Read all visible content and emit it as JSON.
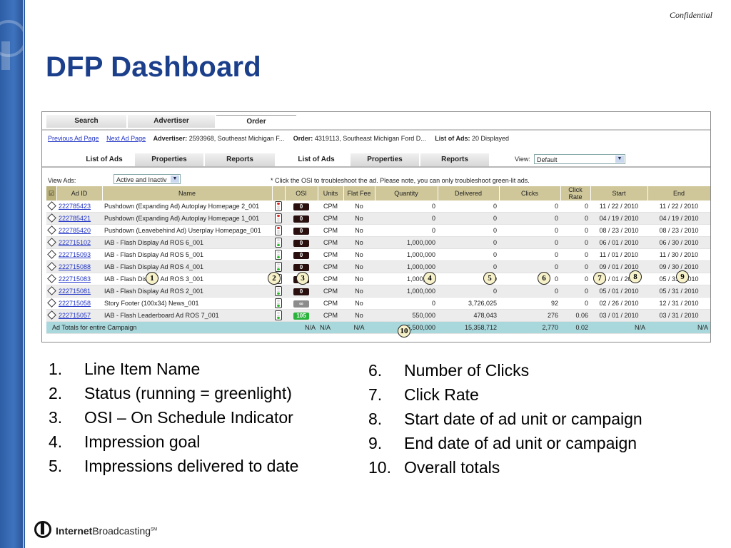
{
  "header": {
    "confidential": "Confidential",
    "title": "DFP Dashboard"
  },
  "tabs1": [
    "Search",
    "Advertiser",
    "Order"
  ],
  "info": {
    "prev_link": "Previous Ad Page",
    "next_link": "Next Ad Page",
    "advertiser_label": "Advertiser:",
    "advertiser_value": "2593968, Southeast Michigan F...",
    "order_label": "Order:",
    "order_value": "4319113, Southeast Michigan Ford D...",
    "list_label": "List of Ads:",
    "list_value": "20 Displayed"
  },
  "tabs2": [
    "List of Ads",
    "Properties",
    "Reports",
    "List of Ads",
    "Properties",
    "Reports"
  ],
  "view": {
    "label": "View:",
    "value": "Default"
  },
  "view_ads": {
    "label": "View Ads:",
    "value": "Active and Inactiv"
  },
  "note": "* Click the OSI to troubleshoot the ad. Please note, you can only troubleshoot green-lit ads.",
  "columns": [
    "Ad ID",
    "Name",
    "OSI",
    "Units",
    "Flat Fee",
    "Quantity",
    "Delivered",
    "Clicks",
    "Click Rate",
    "Start",
    "End"
  ],
  "rows": [
    {
      "id": "222785423",
      "name": "Pushdown (Expanding Ad) Autoplay Homepage 2_001",
      "status": "red",
      "osi": "0",
      "units": "CPM",
      "flat": "No",
      "qty": "0",
      "del": "0",
      "clicks": "0",
      "rate": "0",
      "start": "11 / 22 / 2010",
      "end": "11 / 22 / 2010"
    },
    {
      "id": "222785421",
      "name": "Pushdown (Expanding Ad) Autoplay Homepage 1_001",
      "status": "red",
      "osi": "0",
      "units": "CPM",
      "flat": "No",
      "qty": "0",
      "del": "0",
      "clicks": "0",
      "rate": "0",
      "start": "04 / 19 / 2010",
      "end": "04 / 19 / 2010"
    },
    {
      "id": "222785420",
      "name": "Pushdown (Leavebehind Ad) Userplay Homepage_001",
      "status": "red",
      "osi": "0",
      "units": "CPM",
      "flat": "No",
      "qty": "0",
      "del": "0",
      "clicks": "0",
      "rate": "0",
      "start": "08 / 23 / 2010",
      "end": "08 / 23 / 2010"
    },
    {
      "id": "222715102",
      "name": "IAB - Flash Display Ad ROS 6_001",
      "status": "green",
      "osi": "0",
      "units": "CPM",
      "flat": "No",
      "qty": "1,000,000",
      "del": "0",
      "clicks": "0",
      "rate": "0",
      "start": "06 / 01 / 2010",
      "end": "06 / 30 / 2010"
    },
    {
      "id": "222715093",
      "name": "IAB - Flash Display Ad ROS 5_001",
      "status": "green",
      "osi": "0",
      "units": "CPM",
      "flat": "No",
      "qty": "1,000,000",
      "del": "0",
      "clicks": "0",
      "rate": "0",
      "start": "11 / 01 / 2010",
      "end": "11 / 30 / 2010"
    },
    {
      "id": "222715088",
      "name": "IAB - Flash Display Ad ROS 4_001",
      "status": "green",
      "osi": "0",
      "units": "CPM",
      "flat": "No",
      "qty": "1,000,000",
      "del": "0",
      "clicks": "0",
      "rate": "0",
      "start": "09 / 01 / 2010",
      "end": "09 / 30 / 2010"
    },
    {
      "id": "222715083",
      "name": "IAB - Flash Display Ad ROS 3_001",
      "status": "green",
      "osi": "0",
      "units": "CPM",
      "flat": "No",
      "qty": "1,000,000",
      "del": "0",
      "clicks": "0",
      "rate": "0",
      "start": "05 / 01 / 2010",
      "end": "05 / 31 / 2010"
    },
    {
      "id": "222715081",
      "name": "IAB - Flash Display Ad ROS 2_001",
      "status": "green",
      "osi": "0",
      "units": "CPM",
      "flat": "No",
      "qty": "1,000,000",
      "del": "0",
      "clicks": "0",
      "rate": "0",
      "start": "05 / 01 / 2010",
      "end": "05 / 31 / 2010"
    },
    {
      "id": "222715058",
      "name": "Story Footer (100x34) News_001",
      "status": "green",
      "osi": "∞",
      "units": "CPM",
      "flat": "No",
      "qty": "0",
      "del": "3,726,025",
      "clicks": "92",
      "rate": "0",
      "start": "02 / 26 / 2010",
      "end": "12 / 31 / 2010"
    },
    {
      "id": "222715057",
      "name": "IAB - Flash Leaderboard Ad ROS 7_001",
      "status": "green",
      "osi": "105",
      "units": "CPM",
      "flat": "No",
      "qty": "550,000",
      "del": "478,043",
      "clicks": "276",
      "rate": "0.06",
      "start": "03 / 01 / 2010",
      "end": "03 / 31 / 2010"
    }
  ],
  "totals": {
    "label": "Ad Totals for entire Campaign",
    "osi": "N/A",
    "units": "N/A",
    "flat": "N/A",
    "qty": "15,500,000",
    "del": "15,358,712",
    "clicks": "2,770",
    "rate": "0.02",
    "start": "N/A",
    "end": "N/A"
  },
  "callouts": [
    "1",
    "2",
    "3",
    "4",
    "5",
    "6",
    "7",
    "8",
    "9",
    "10"
  ],
  "legend_left": [
    {
      "n": "1.",
      "t": "Line Item Name"
    },
    {
      "n": "2.",
      "t": "Status (running = greenlight)"
    },
    {
      "n": "3.",
      "t": "OSI – On Schedule Indicator"
    },
    {
      "n": "4.",
      "t": "Impression goal"
    },
    {
      "n": "5.",
      "t": "Impressions delivered to date"
    }
  ],
  "legend_right": [
    {
      "n": "6.",
      "t": "Number of Clicks"
    },
    {
      "n": "7.",
      "t": "Click Rate"
    },
    {
      "n": "8.",
      "t": "Start date of ad unit or campaign"
    },
    {
      "n": "9.",
      "t": "End date of ad unit or campaign"
    },
    {
      "n": "10.",
      "t": "Overall totals"
    }
  ],
  "footer": {
    "brand_bold": "Internet",
    "brand_rest": "Broadcasting",
    "brand_tm": "SM"
  }
}
